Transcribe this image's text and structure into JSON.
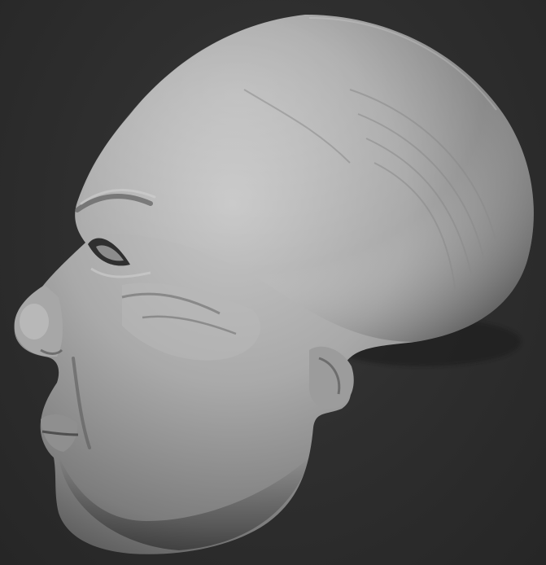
{
  "scene": {
    "subject_icon": "sculpted-head-icon",
    "colors": {
      "background_center": "#3a3a3a",
      "background_edge": "#262626",
      "clay_light": "#c9c9c9",
      "clay_mid": "#9a9a9a",
      "clay_dark": "#4a4a4a"
    }
  }
}
